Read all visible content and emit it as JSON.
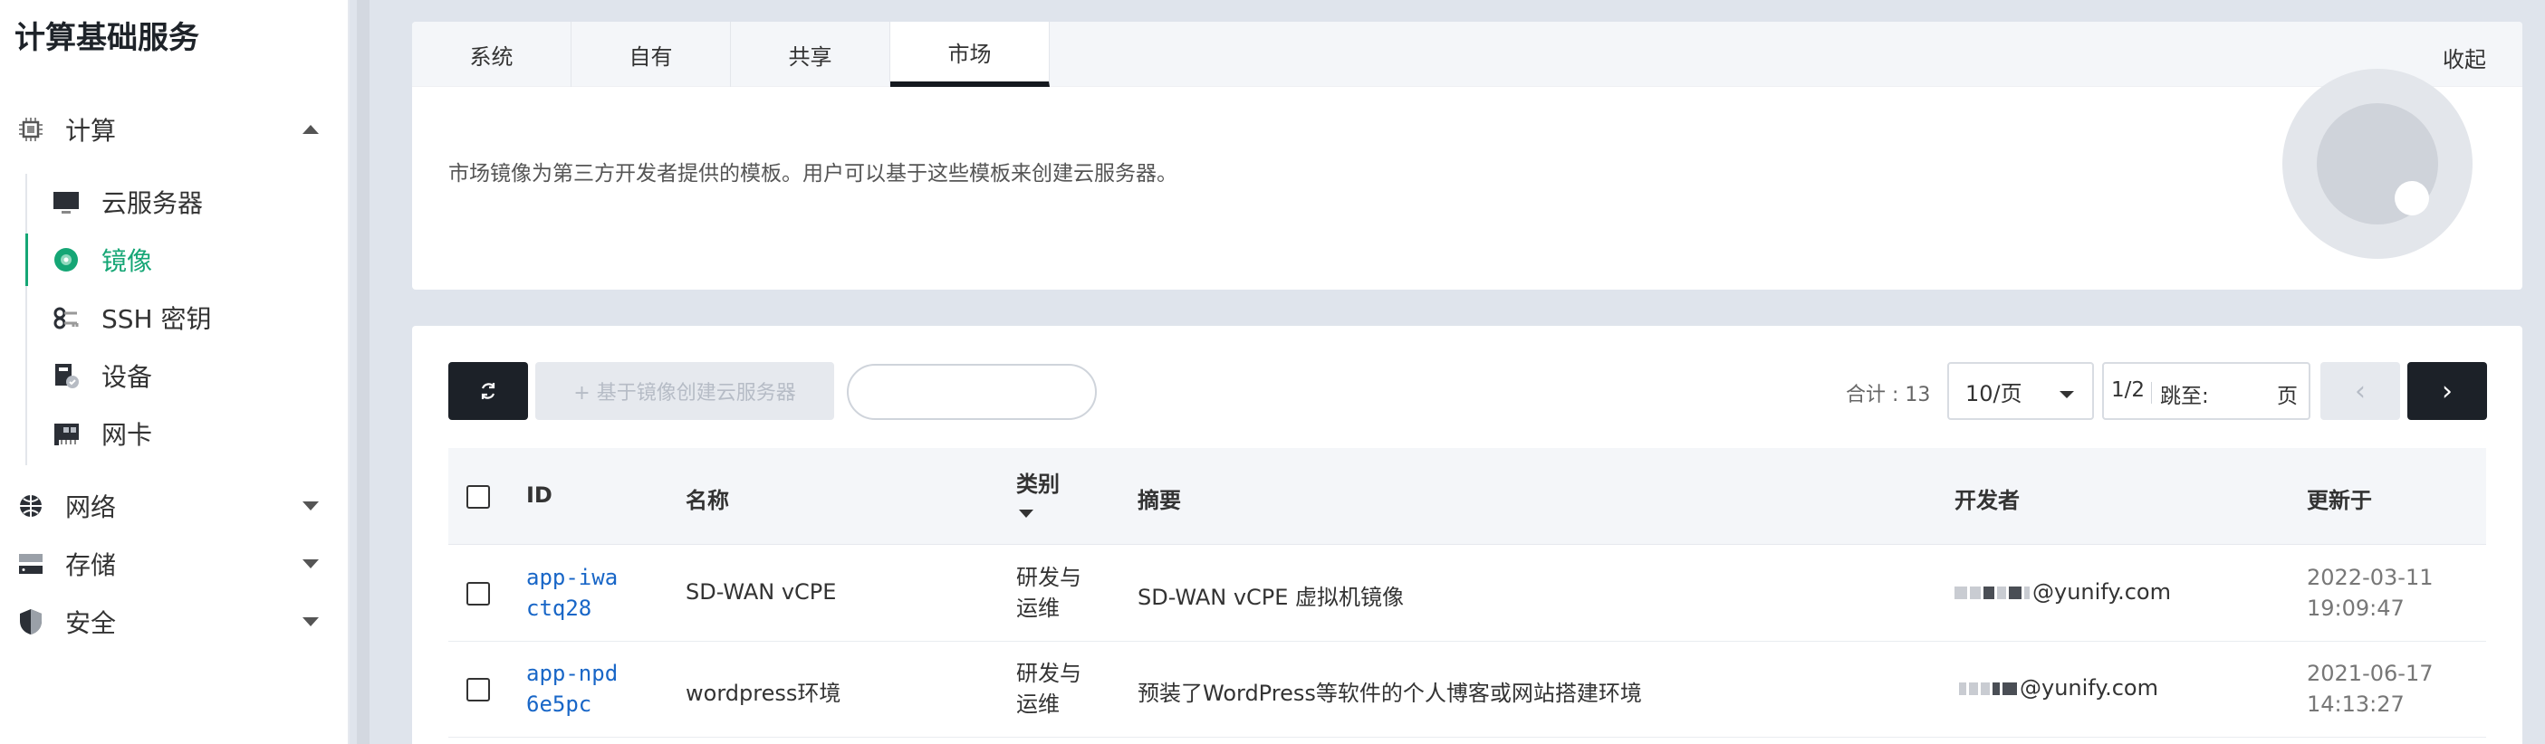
{
  "sidebar": {
    "title": "计算基础服务",
    "groups": [
      {
        "label": "计算"
      },
      {
        "label": "网络"
      },
      {
        "label": "存储"
      },
      {
        "label": "安全"
      }
    ],
    "compute_items": [
      {
        "label": "云服务器"
      },
      {
        "label": "镜像"
      },
      {
        "label": "SSH 密钥"
      },
      {
        "label": "设备"
      },
      {
        "label": "网卡"
      }
    ]
  },
  "tabs": [
    {
      "label": "系统"
    },
    {
      "label": "自有"
    },
    {
      "label": "共享"
    },
    {
      "label": "市场"
    }
  ],
  "active_tab": "市场",
  "collapse_label": "收起",
  "description": "市场镜像为第三方开发者提供的模板。用户可以基于这些模板来创建云服务器。",
  "toolbar": {
    "create_label": "+ 基于镜像创建云服务器",
    "search_placeholder": "",
    "total_label": "合计 : 13",
    "page_size": "10/页",
    "page_indicator": "1/2",
    "jump_label": "跳至:",
    "page_unit": "页",
    "prev_symbol": "‹",
    "next_symbol": "›"
  },
  "table": {
    "headers": {
      "id": "ID",
      "name": "名称",
      "category": "类别",
      "summary": "摘要",
      "developer": "开发者",
      "updated": "更新于"
    },
    "rows": [
      {
        "id_line1": "app-iwa",
        "id_line2": "ctq28",
        "name": "SD-WAN vCPE",
        "category_line1": "研发与",
        "category_line2": "运维",
        "summary": "SD-WAN vCPE 虚拟机镜像",
        "developer": "@yunify.com",
        "updated_line1": "2022-03-11",
        "updated_line2": "19:09:47"
      },
      {
        "id_line1": "app-npd",
        "id_line2": "6e5pc",
        "name": "wordpress环境",
        "category_line1": "研发与",
        "category_line2": "运维",
        "summary": "预装了WordPress等软件的个人博客或网站搭建环境",
        "developer": "@yunify.com",
        "updated_line1": "2021-06-17",
        "updated_line2": "14:13:27"
      }
    ]
  },
  "colors": {
    "accent": "#15a675",
    "dark": "#1c2128",
    "link": "#1866c7"
  }
}
